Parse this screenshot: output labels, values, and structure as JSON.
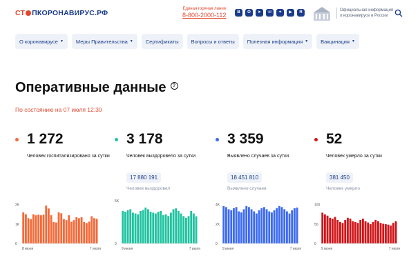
{
  "header": {
    "logo_part1": "СТ",
    "logo_part2": "ПКОРОНАВИРУС.РФ",
    "hotline_caption": "Единая горячая линия",
    "hotline_number": "8-800-2000-112",
    "socials": [
      "vk-icon",
      "ok-icon",
      "telegram-icon",
      "viber-icon",
      "zen-icon",
      "youtube-icon",
      "rutube-icon"
    ],
    "gov_text": "Официальная информация о коронавирусе в России"
  },
  "nav": [
    {
      "label": "О коронавирусе",
      "has_caret": true
    },
    {
      "label": "Меры Правительства",
      "has_caret": true
    },
    {
      "label": "Сертификаты",
      "has_caret": false
    },
    {
      "label": "Вопросы и ответы",
      "has_caret": false
    },
    {
      "label": "Полезная информация",
      "has_caret": true
    },
    {
      "label": "Вакцинация",
      "has_caret": true
    }
  ],
  "title": "Оперативные данные",
  "subtitle": "По состоянию на 07 июля 12:30",
  "colors": {
    "accent_red": "#e2472e",
    "brand_blue": "#1a3b8a"
  },
  "cards": [
    {
      "value": "1 272",
      "label": "Человек госпитализировано за сутки",
      "total": "",
      "total_caption": "",
      "color": "#f26b3a",
      "chart_data": {
        "type": "bar",
        "x_start_label": "8 июня",
        "x_end_label": "7 июля",
        "y_ticks": [
          "0",
          "1K",
          "2K"
        ],
        "ylim": [
          0,
          2200
        ],
        "values": [
          1600,
          1500,
          1300,
          1250,
          1500,
          1450,
          1480,
          1450,
          1480,
          1950,
          1800,
          1450,
          1100,
          1080,
          1600,
          1550,
          1250,
          1200,
          1450,
          1120,
          1200,
          1350,
          1300,
          1350,
          1100,
          1050,
          1120,
          1400,
          1300,
          1272
        ]
      }
    },
    {
      "value": "3 178",
      "label": "Человек выздоровело за сутки",
      "total": "17 880 191",
      "total_caption": "Человек выздоровел",
      "color": "#1fc3a0",
      "chart_data": {
        "type": "bar",
        "x_start_label": "9 июня",
        "x_end_label": "7 июля",
        "y_ticks": [
          "0",
          "5K"
        ],
        "ylim": [
          0,
          5000
        ],
        "values": [
          3800,
          3700,
          3900,
          4000,
          3600,
          3500,
          3400,
          3800,
          3900,
          4200,
          4000,
          3700,
          3600,
          3500,
          3700,
          3800,
          3300,
          3400,
          3200,
          3600,
          4000,
          4100,
          3800,
          3500,
          3200,
          3000,
          3200,
          3800,
          3500,
          3178
        ]
      }
    },
    {
      "value": "3 359",
      "label": "Выявлено случаев за сутки",
      "total": "18 451 810",
      "total_caption": "Выявлено случаев",
      "color": "#3d6bef",
      "chart_data": {
        "type": "bar",
        "x_start_label": "9 июня",
        "x_end_label": "7 июля",
        "y_ticks": [
          "0",
          "2K",
          "4K"
        ],
        "ylim": [
          0,
          4000
        ],
        "values": [
          3500,
          3400,
          3200,
          3100,
          3300,
          3400,
          3000,
          2900,
          3200,
          3500,
          3400,
          3200,
          3000,
          2800,
          3100,
          3300,
          3400,
          3200,
          3000,
          2900,
          3100,
          3300,
          3500,
          3400,
          3200,
          3000,
          2800,
          3100,
          3300,
          3359
        ]
      }
    },
    {
      "value": "52",
      "label": "Человек умерло за сутки",
      "total": "381 450",
      "total_caption": "Человек умерло",
      "color": "#d0161a",
      "chart_data": {
        "type": "bar",
        "x_start_label": "9 июня",
        "x_end_label": "7 июля",
        "y_ticks": [
          "0",
          "50",
          "100"
        ],
        "ylim": [
          0,
          100
        ],
        "values": [
          72,
          68,
          65,
          60,
          58,
          62,
          55,
          50,
          48,
          55,
          60,
          58,
          52,
          50,
          48,
          55,
          58,
          52,
          49,
          45,
          50,
          55,
          52,
          48,
          46,
          45,
          44,
          42,
          48,
          52
        ]
      }
    }
  ]
}
